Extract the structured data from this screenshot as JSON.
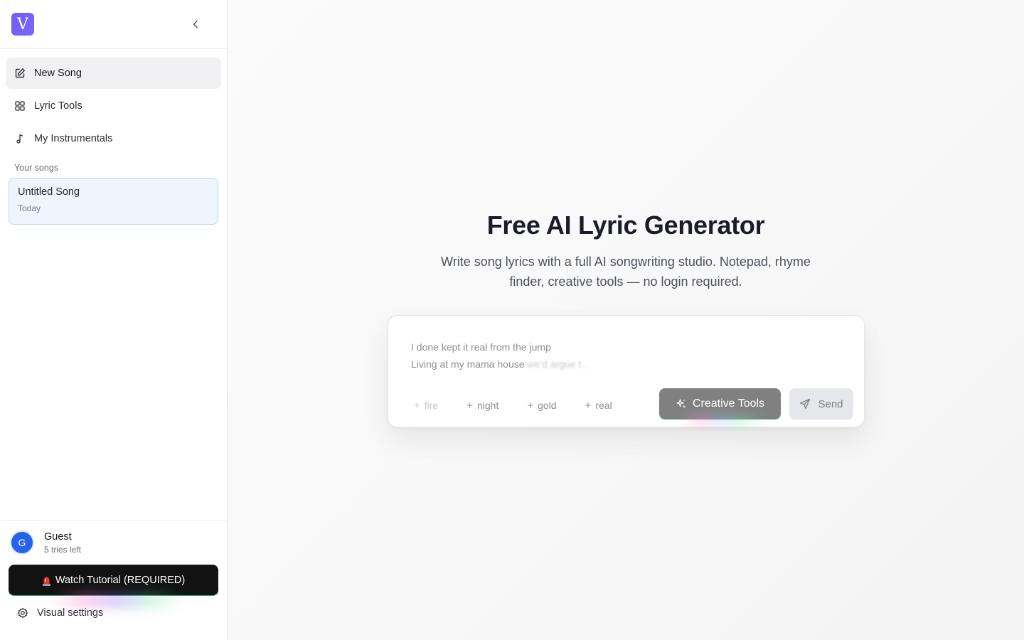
{
  "sidebar": {
    "logo_letter": "V",
    "nav": [
      {
        "label": "New Song",
        "icon": "edit-icon"
      },
      {
        "label": "Lyric Tools",
        "icon": "grid-icon"
      },
      {
        "label": "My Instrumentals",
        "icon": "music-note-icon"
      }
    ],
    "section_label": "Your songs",
    "songs": [
      {
        "title": "Untitled Song",
        "date": "Today"
      }
    ],
    "user": {
      "initial": "G",
      "name": "Guest",
      "tries": "5 tries left"
    },
    "tutorial_button": "Watch Tutorial (REQUIRED)",
    "settings_label": "Visual settings"
  },
  "main": {
    "title": "Free AI Lyric Generator",
    "subtitle": "Write song lyrics with a full AI songwriting studio. Notepad, rhyme finder, creative tools — no login required.",
    "composer": {
      "line1": "I done kept it real from the jump",
      "line2_visible": "Living at my mama house",
      "line2_fading": "we'd argue t...",
      "chips": [
        "fire",
        "night",
        "gold",
        "real"
      ],
      "creative_tools_label": "Creative Tools",
      "send_label": "Send"
    }
  },
  "colors": {
    "brand": "#6d5cf6",
    "avatar": "#2463eb",
    "active_song_bg": "#eef5fd",
    "active_song_border": "#bcd6f5"
  }
}
